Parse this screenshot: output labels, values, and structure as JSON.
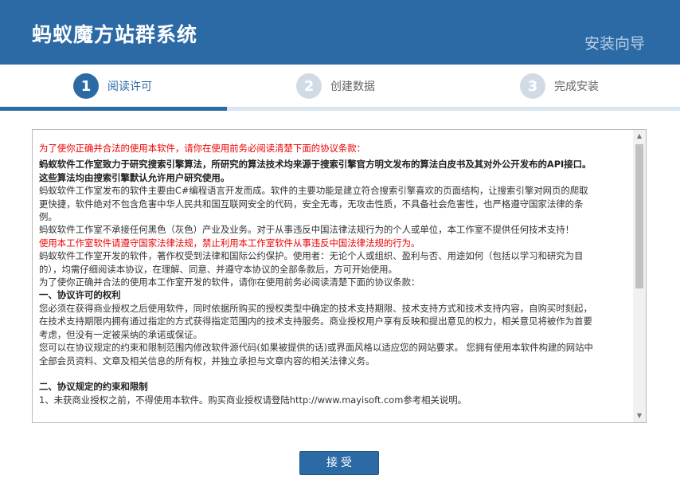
{
  "header": {
    "app_title": "蚂蚁魔方站群系统",
    "wizard_title": "安装向导"
  },
  "steps": [
    {
      "number": "1",
      "label": "阅读许可",
      "active": true
    },
    {
      "number": "2",
      "label": "创建数据",
      "active": false
    },
    {
      "number": "3",
      "label": "完成安装",
      "active": false
    }
  ],
  "colors": {
    "accent": "#2c6aa6",
    "inactive_step": "#d0dbe6",
    "warning_text": "#e00000"
  },
  "license": {
    "notice": "为了使你正确并合法的使用本软件，请你在使用前务必阅读清楚下面的协议条款：",
    "bold_intro_1": "蚂蚁软件工作室致力于研究搜索引擎算法，所研究的算法技术均来源于搜索引擎官方明文发布的算法白皮书及其对外公开发布的API接口。",
    "bold_intro_2": "这些算法均由搜索引擎默认允许用户研究使用。",
    "para_1a": "蚂蚁软件工作室发布的软件主要由C#编程语言开发而成。软件的主要功能是建立符合搜索引擎喜欢的页面结构，让搜索引擎对网页的爬取",
    "para_1b": "更快捷，软件绝对不包含危害中华人民共和国互联网安全的代码，安全无毒，无攻击性质，不具备社会危害性，也严格遵守国家法律的条",
    "para_1c": "例。",
    "para_2": "蚂蚁软件工作室不承接任何黑色（灰色）产业及业务。对于从事违反中国法律法规行为的个人或单位，本工作室不提供任何技术支持！",
    "red_warning": "使用本工作室软件请遵守国家法律法规，禁止利用本工作室软件从事违反中国法律法规的行为。",
    "para_3a": "蚂蚁软件工作室开发的软件，著作权受到法律和国际公约保护。使用者：无论个人或组织、盈利与否、用途如何（包括以学习和研究为目",
    "para_3b": "的），均需仔细阅读本协议，在理解、同意、并遵守本协议的全部条款后，方可开始使用。",
    "para_4": "为了使你正确并合法的使用本工作室开发的软件，请你在使用前务必阅读清楚下面的协议条款：",
    "section_1_title": "一、协议许可的权利",
    "para_5a": "您必须在获得商业授权之后使用软件，同时依据所购买的授权类型中确定的技术支持期限、技术支持方式和技术支持内容，自购买时刻起，",
    "para_5b": "在技术支持期限内拥有通过指定的方式获得指定范围内的技术支持服务。商业授权用户享有反映和提出意见的权力，相关意见将被作为首要",
    "para_5c": "考虑，但没有一定被采纳的承诺或保证。",
    "para_6a": "您可以在协议规定的约束和限制范围内修改软件源代码(如果被提供的话)或界面风格以适应您的网站要求。 您拥有使用本软件构建的网站中",
    "para_6b": "全部会员资料、文章及相关信息的所有权，并独立承担与文章内容的相关法律义务。",
    "section_2_title": "二、协议规定的约束和限制",
    "para_7_partial": "1、未获商业授权之前，不得使用本软件。购买商业授权请登陆http://www.mayisoft.com参考相关说明。"
  },
  "scrollbar": {
    "up_glyph": "▲",
    "down_glyph": "▼"
  },
  "buttons": {
    "accept": "接受"
  }
}
